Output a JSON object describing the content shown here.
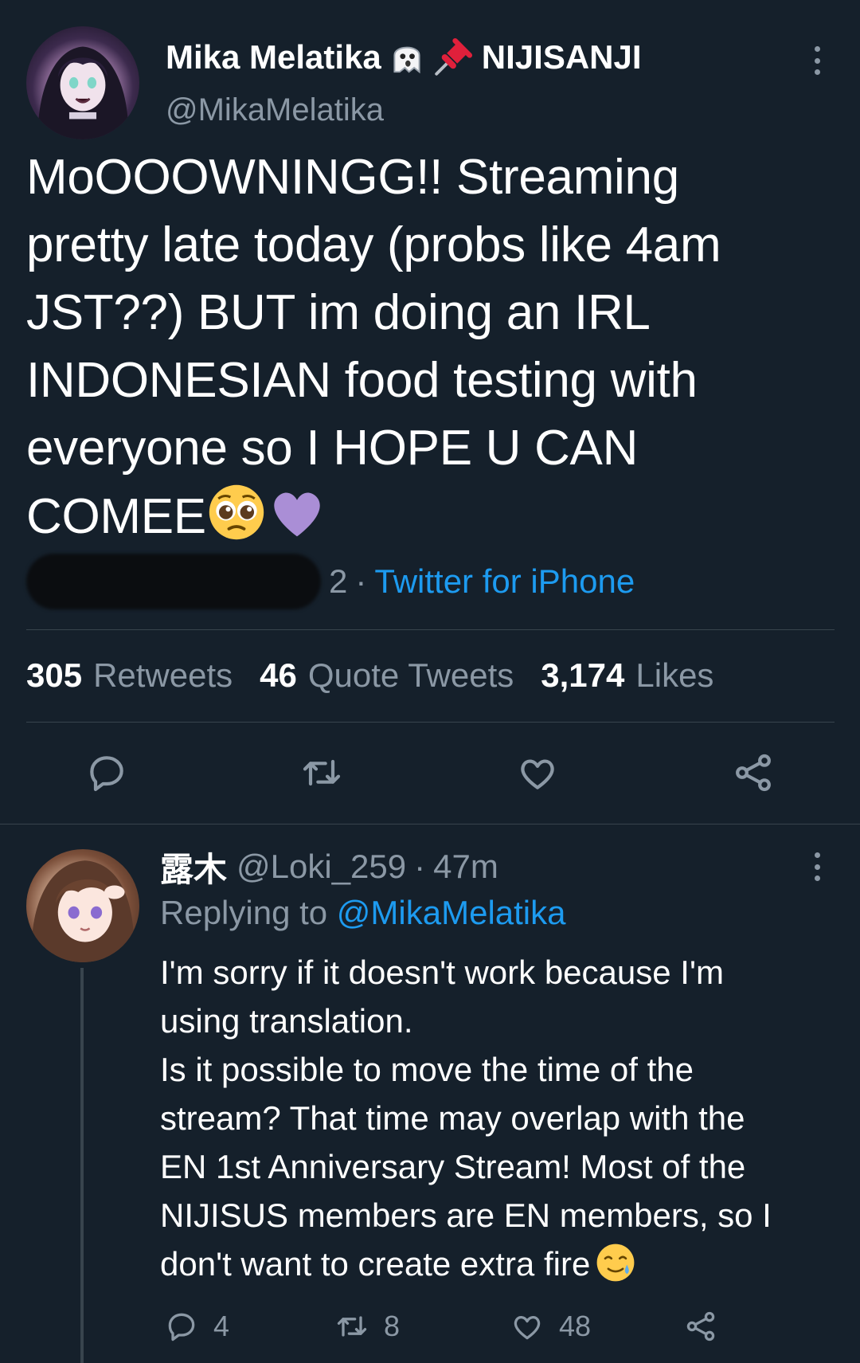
{
  "main_tweet": {
    "author": {
      "name": "Mika Melatika",
      "name_emojis": [
        "ghost-emoji",
        "pushpin-emoji"
      ],
      "affiliation": "NIJISANJI",
      "handle": "@MikaMelatika"
    },
    "body_lines": [
      "MoOOOWNINGG!! Streaming",
      "pretty late today (probs like 4am",
      "JST??) BUT im doing an IRL",
      "INDONESIAN food testing with",
      "everyone so I HOPE U CAN",
      "COMEE"
    ],
    "body_end_emojis": [
      "pleading-face-emoji",
      "purple-heart-emoji"
    ],
    "meta": {
      "redacted_partial": "2",
      "separator": "·",
      "source": "Twitter for iPhone"
    },
    "stats": {
      "retweets_count": "305",
      "retweets_label": "Retweets",
      "quotes_count": "46",
      "quotes_label": "Quote Tweets",
      "likes_count": "3,174",
      "likes_label": "Likes"
    },
    "actions": [
      "reply-icon",
      "retweet-icon",
      "like-icon",
      "share-icon"
    ]
  },
  "reply_tweet": {
    "author": {
      "name": "露木",
      "handle": "@Loki_259",
      "separator": "·",
      "time": "47m"
    },
    "replying_to_label": "Replying to",
    "replying_to_handle": "@MikaMelatika",
    "body_lines": [
      "I'm sorry if it doesn't work because I'm",
      "using translation.",
      "Is it possible to move the time of the",
      "stream? That time may overlap with the",
      "EN 1st Anniversary Stream!  Most of the",
      "NIJISUS members are EN members, so I",
      "don't want to create extra fire"
    ],
    "body_end_emoji": "smiling-face-with-tear-emoji",
    "actions": {
      "reply_count": "4",
      "retweet_count": "8",
      "like_count": "48"
    }
  },
  "colors": {
    "background": "#15202b",
    "divider": "#38444d",
    "text_primary": "#ffffff",
    "text_secondary": "#8b98a5",
    "link": "#1d9bf0"
  }
}
